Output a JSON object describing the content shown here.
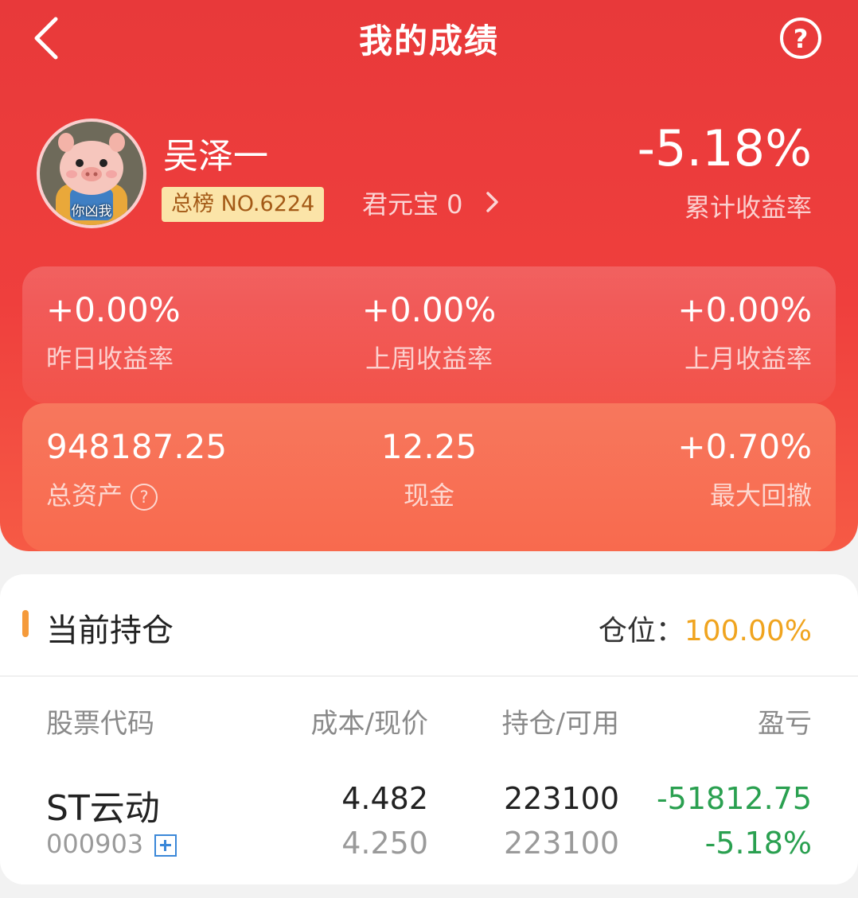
{
  "header": {
    "title": "我的成绩"
  },
  "profile": {
    "username": "吴泽一",
    "avatar_caption": "你凶我",
    "rank_label": "总榜 NO.6224",
    "coin_label": "君元宝 0",
    "total_return": "-5.18%",
    "total_return_label": "累计收益率"
  },
  "returns": [
    {
      "value": "+0.00%",
      "label": "昨日收益率"
    },
    {
      "value": "+0.00%",
      "label": "上周收益率"
    },
    {
      "value": "+0.00%",
      "label": "上月收益率"
    }
  ],
  "assets": [
    {
      "value": "948187.25",
      "label": "总资产"
    },
    {
      "value": "12.25",
      "label": "现金"
    },
    {
      "value": "+0.70%",
      "label": "最大回撤"
    }
  ],
  "holdings": {
    "title": "当前持仓",
    "position_label": "仓位：",
    "position_value": "100.00%",
    "columns": [
      "股票代码",
      "成本/现价",
      "持仓/可用",
      "盈亏"
    ],
    "rows": [
      {
        "name": "ST云动",
        "code": "000903",
        "cost": "4.482",
        "price": "4.250",
        "holding": "223100",
        "available": "223100",
        "pnl": "-51812.75",
        "pnl_pct": "-5.18%"
      }
    ]
  },
  "colors": {
    "brand_red": "#e8393a",
    "loss_green": "#2aa050",
    "position_orange": "#f0a41f",
    "accent_bar": "#f59a3a"
  }
}
